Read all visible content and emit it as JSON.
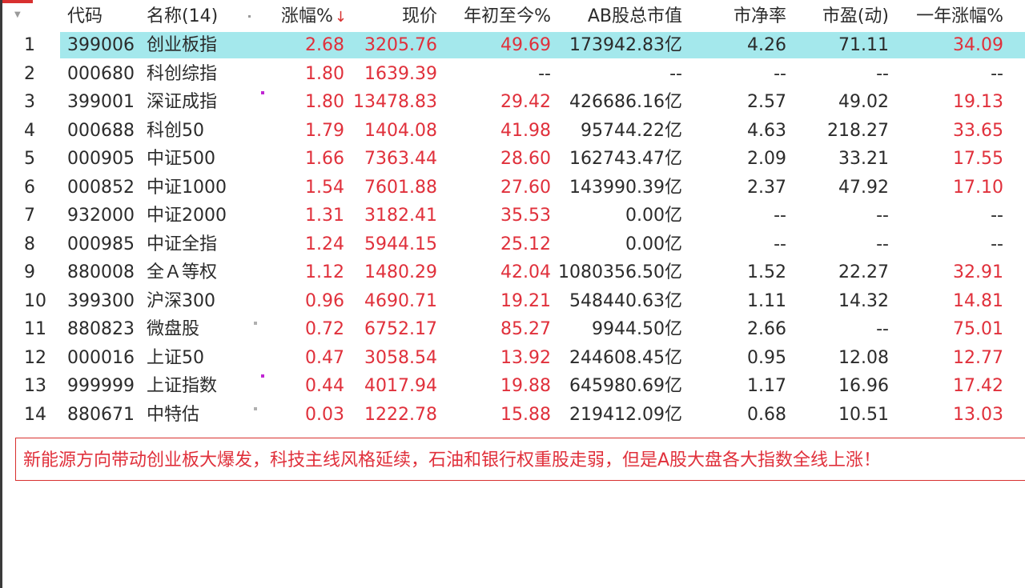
{
  "colors": {
    "up": "#e0303b",
    "selected_row": "#a4e8ec",
    "text": "#2b2b2b",
    "accent": "#d8302f"
  },
  "header": {
    "menu_icon": "triangle-down-icon",
    "code": "代码",
    "name": "名称(14)",
    "change": "涨幅%",
    "sort_arrow": "↓",
    "price": "现价",
    "ytd": "年初至今%",
    "market_cap": "AB股总市值",
    "pb": "市净率",
    "pe": "市盈(动)",
    "one_year": "一年涨幅%"
  },
  "rows": [
    {
      "idx": "1",
      "code": "399006",
      "name": "创业板指",
      "change": "2.68",
      "price": "3205.76",
      "ytd": "49.69",
      "market_cap": "173942.83亿",
      "pb": "4.26",
      "pe": "71.11",
      "one_year": "34.09"
    },
    {
      "idx": "2",
      "code": "000680",
      "name": "科创综指",
      "change": "1.80",
      "price": "1639.39",
      "ytd": "--",
      "market_cap": "--",
      "pb": "--",
      "pe": "--",
      "one_year": "--"
    },
    {
      "idx": "3",
      "code": "399001",
      "name": "深证成指",
      "change": "1.80",
      "price": "13478.83",
      "ytd": "29.42",
      "market_cap": "426686.16亿",
      "pb": "2.57",
      "pe": "49.02",
      "one_year": "19.13"
    },
    {
      "idx": "4",
      "code": "000688",
      "name": "科创50",
      "change": "1.79",
      "price": "1404.08",
      "ytd": "41.98",
      "market_cap": "95744.22亿",
      "pb": "4.63",
      "pe": "218.27",
      "one_year": "33.65"
    },
    {
      "idx": "5",
      "code": "000905",
      "name": "中证500",
      "change": "1.66",
      "price": "7363.44",
      "ytd": "28.60",
      "market_cap": "162743.47亿",
      "pb": "2.09",
      "pe": "33.21",
      "one_year": "17.55"
    },
    {
      "idx": "6",
      "code": "000852",
      "name": "中证1000",
      "change": "1.54",
      "price": "7601.88",
      "ytd": "27.60",
      "market_cap": "143990.39亿",
      "pb": "2.37",
      "pe": "47.92",
      "one_year": "17.10"
    },
    {
      "idx": "7",
      "code": "932000",
      "name": "中证2000",
      "change": "1.31",
      "price": "3182.41",
      "ytd": "35.53",
      "market_cap": "0.00亿",
      "pb": "--",
      "pe": "--",
      "one_year": "--"
    },
    {
      "idx": "8",
      "code": "000985",
      "name": "中证全指",
      "change": "1.24",
      "price": "5944.15",
      "ytd": "25.12",
      "market_cap": "0.00亿",
      "pb": "--",
      "pe": "--",
      "one_year": "--"
    },
    {
      "idx": "9",
      "code": "880008",
      "name": "全Ａ等权",
      "change": "1.12",
      "price": "1480.29",
      "ytd": "42.04",
      "market_cap": "1080356.50亿",
      "pb": "1.52",
      "pe": "22.27",
      "one_year": "32.91"
    },
    {
      "idx": "10",
      "code": "399300",
      "name": "沪深300",
      "change": "0.96",
      "price": "4690.71",
      "ytd": "19.21",
      "market_cap": "548440.63亿",
      "pb": "1.11",
      "pe": "14.32",
      "one_year": "14.81"
    },
    {
      "idx": "11",
      "code": "880823",
      "name": "微盘股",
      "change": "0.72",
      "price": "6752.17",
      "ytd": "85.27",
      "market_cap": "9944.50亿",
      "pb": "2.66",
      "pe": "--",
      "one_year": "75.01"
    },
    {
      "idx": "12",
      "code": "000016",
      "name": "上证50",
      "change": "0.47",
      "price": "3058.54",
      "ytd": "13.92",
      "market_cap": "244608.45亿",
      "pb": "0.95",
      "pe": "12.08",
      "one_year": "12.77"
    },
    {
      "idx": "13",
      "code": "999999",
      "name": "上证指数",
      "change": "0.44",
      "price": "4017.94",
      "ytd": "19.88",
      "market_cap": "645980.69亿",
      "pb": "1.17",
      "pe": "16.96",
      "one_year": "17.42"
    },
    {
      "idx": "14",
      "code": "880671",
      "name": "中特估",
      "change": "0.03",
      "price": "1222.78",
      "ytd": "15.88",
      "market_cap": "219412.09亿",
      "pb": "0.68",
      "pe": "10.51",
      "one_year": "13.03"
    }
  ],
  "comment": {
    "text": "新能源方向带动创业板大爆发，科技主线风格延续，石油和银行权重股走弱，但是A股大盘各大指数全线上涨！"
  }
}
